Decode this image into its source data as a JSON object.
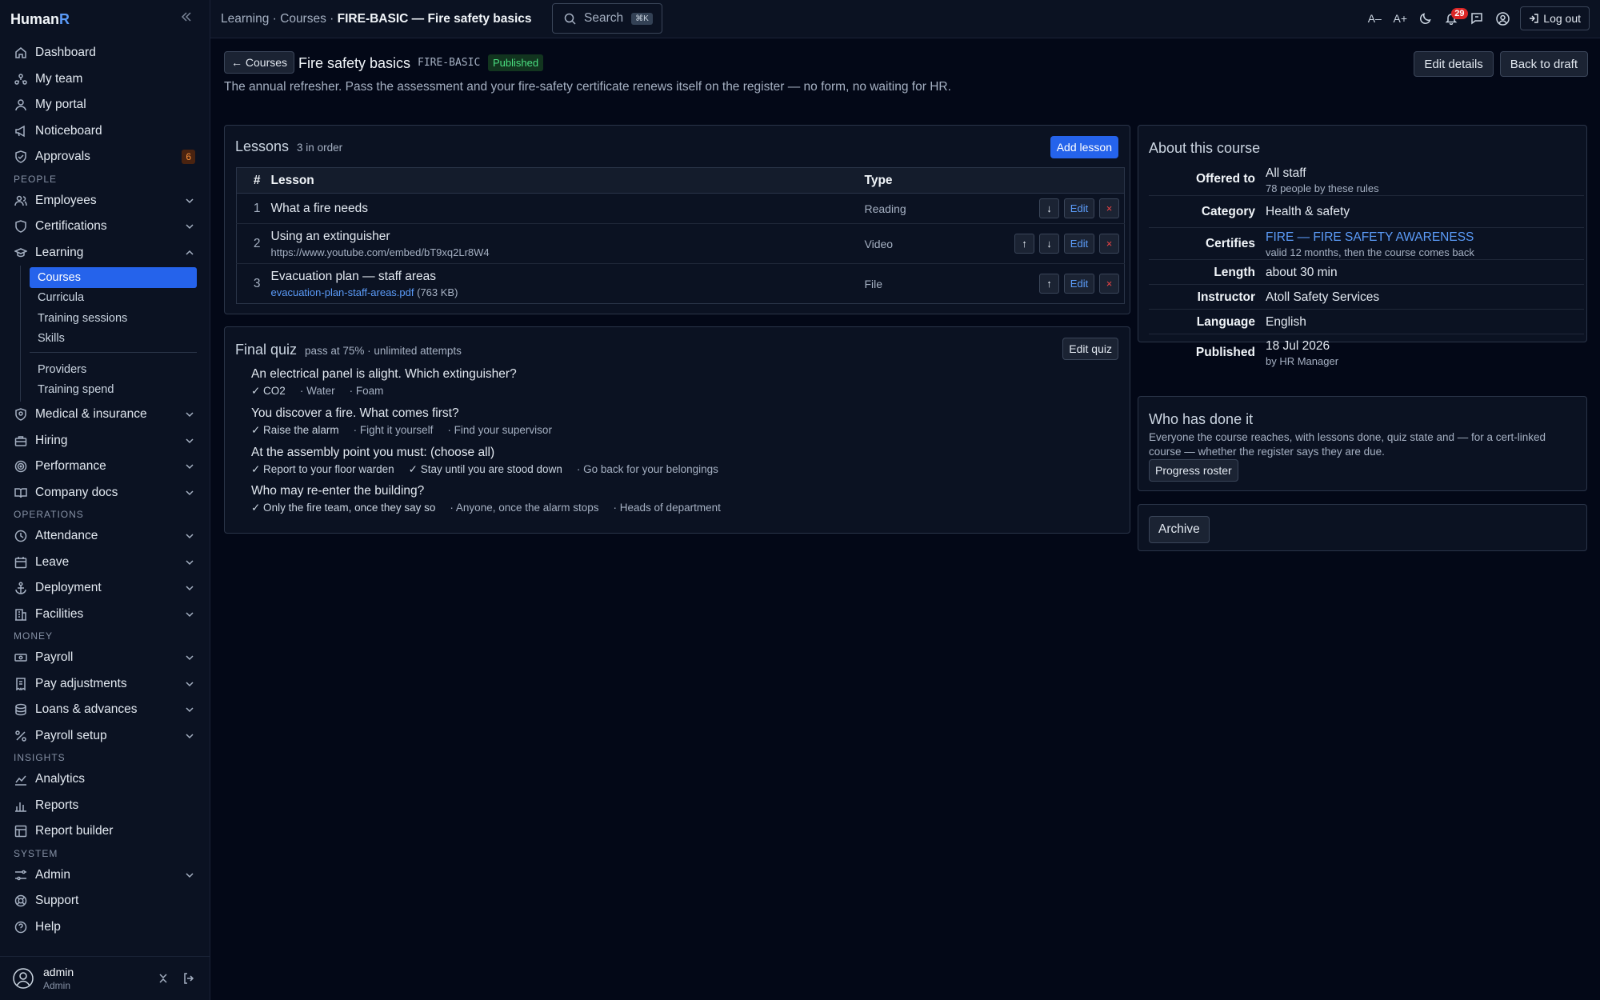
{
  "app": {
    "brand_main": "Human",
    "brand_accent": "R"
  },
  "nav": {
    "top": [
      {
        "label": "Dashboard",
        "icon": "home-icon"
      },
      {
        "label": "My team",
        "icon": "team-icon"
      },
      {
        "label": "My portal",
        "icon": "user-icon"
      },
      {
        "label": "Noticeboard",
        "icon": "megaphone-icon"
      },
      {
        "label": "Approvals",
        "icon": "shield-check-icon",
        "badge": "6"
      }
    ],
    "people_header": "PEOPLE",
    "people": [
      {
        "label": "Employees",
        "icon": "users-icon"
      },
      {
        "label": "Certifications",
        "icon": "certificate-icon"
      },
      {
        "label": "Learning",
        "icon": "graduation-cap-icon"
      }
    ],
    "learning_sub": [
      "Courses",
      "Curricula",
      "Training sessions",
      "Skills",
      "Providers",
      "Training spend"
    ],
    "people_more": [
      {
        "label": "Medical & insurance",
        "icon": "medical-shield-icon"
      },
      {
        "label": "Hiring",
        "icon": "briefcase-icon"
      },
      {
        "label": "Performance",
        "icon": "target-icon"
      },
      {
        "label": "Company docs",
        "icon": "book-icon"
      }
    ],
    "operations_header": "OPERATIONS",
    "operations": [
      {
        "label": "Attendance",
        "icon": "clock-icon"
      },
      {
        "label": "Leave",
        "icon": "calendar-icon"
      },
      {
        "label": "Deployment",
        "icon": "anchor-icon"
      },
      {
        "label": "Facilities",
        "icon": "building-icon"
      }
    ],
    "money_header": "MONEY",
    "money": [
      {
        "label": "Payroll",
        "icon": "banknote-icon"
      },
      {
        "label": "Pay adjustments",
        "icon": "receipt-icon"
      },
      {
        "label": "Loans & advances",
        "icon": "coins-icon"
      },
      {
        "label": "Payroll setup",
        "icon": "percent-icon"
      }
    ],
    "insights_header": "INSIGHTS",
    "insights": [
      {
        "label": "Analytics",
        "icon": "chart-line-icon"
      },
      {
        "label": "Reports",
        "icon": "chart-bar-icon"
      },
      {
        "label": "Report builder",
        "icon": "layout-icon"
      }
    ],
    "system_header": "SYSTEM",
    "system": [
      {
        "label": "Admin",
        "icon": "sliders-icon"
      },
      {
        "label": "Support",
        "icon": "lifebuoy-icon"
      },
      {
        "label": "Help",
        "icon": "help-circle-icon"
      }
    ]
  },
  "user": {
    "name": "admin",
    "role": "Admin"
  },
  "topbar": {
    "crumb_1": "Learning",
    "crumb_2": "Courses",
    "crumb_current": "FIRE-BASIC — Fire safety basics",
    "sep": "·",
    "search_placeholder": "Search",
    "search_kbd": "⌘K",
    "font_dec": "A–",
    "font_inc": "A+",
    "notif_count": "29",
    "logout": "Log out"
  },
  "course": {
    "back_label": "← Courses",
    "title": "Fire safety basics",
    "code": "FIRE-BASIC",
    "status": "Published",
    "edit_details": "Edit details",
    "back_to_draft": "Back to draft",
    "description": "The annual refresher. Pass the assessment and your fire-safety certificate renews itself on the register — no form, no waiting for HR."
  },
  "lessons": {
    "title": "Lessons",
    "subtitle": "3 in order",
    "add_label": "Add lesson",
    "col_num": "#",
    "col_lesson": "Lesson",
    "col_type": "Type",
    "edit_label": "Edit",
    "remove_label": "×",
    "up_label": "↑",
    "down_label": "↓",
    "rows": [
      {
        "num": "1",
        "title": "What a fire needs",
        "type": "Reading"
      },
      {
        "num": "2",
        "title": "Using an extinguisher",
        "sub": "https://www.youtube.com/embed/bT9xq2Lr8W4",
        "type": "Video"
      },
      {
        "num": "3",
        "title": "Evacuation plan — staff areas",
        "file": "evacuation-plan-staff-areas.pdf",
        "size": "(763 KB)",
        "type": "File"
      }
    ]
  },
  "quiz": {
    "title": "Final quiz",
    "subtitle": "pass at 75% · unlimited attempts",
    "edit_label": "Edit quiz",
    "questions": [
      {
        "q": "An electrical panel is alight. Which extinguisher?",
        "options": [
          "✓ CO2",
          "· Water",
          "· Foam"
        ]
      },
      {
        "q": "You discover a fire. What comes first?",
        "options": [
          "✓ Raise the alarm",
          "· Fight it yourself",
          "· Find your supervisor"
        ]
      },
      {
        "q": "At the assembly point you must: (choose all)",
        "options": [
          "✓ Report to your floor warden",
          "✓ Stay until you are stood down",
          "· Go back for your belongings"
        ]
      },
      {
        "q": "Who may re-enter the building?",
        "options": [
          "✓ Only the fire team, once they say so",
          "· Anyone, once the alarm stops",
          "· Heads of department"
        ]
      }
    ]
  },
  "about": {
    "title": "About this course",
    "offered_k": "Offered to",
    "offered_v": "All staff",
    "offered_sub": "78 people by these rules",
    "category_k": "Category",
    "category_v": "Health & safety",
    "certifies_k": "Certifies",
    "certifies_v": "FIRE — FIRE SAFETY AWARENESS",
    "certifies_sub": "valid 12 months, then the course comes back",
    "length_k": "Length",
    "length_v": "about 30 min",
    "instructor_k": "Instructor",
    "instructor_v": "Atoll Safety Services",
    "language_k": "Language",
    "language_v": "English",
    "published_k": "Published",
    "published_v": "18 Jul 2026",
    "published_sub": "by HR Manager"
  },
  "who": {
    "title": "Who has done it",
    "desc": "Everyone the course reaches, with lessons done, quiz state and — for a cert-linked course — whether the register says they are due.",
    "button": "Progress roster"
  },
  "archive": {
    "button": "Archive"
  },
  "colors": {
    "accent": "#2563eb",
    "link": "#5b9bf8",
    "success": "#4ade80",
    "danger": "#ef4444",
    "bg": "#030817",
    "panel": "#0b1222"
  }
}
